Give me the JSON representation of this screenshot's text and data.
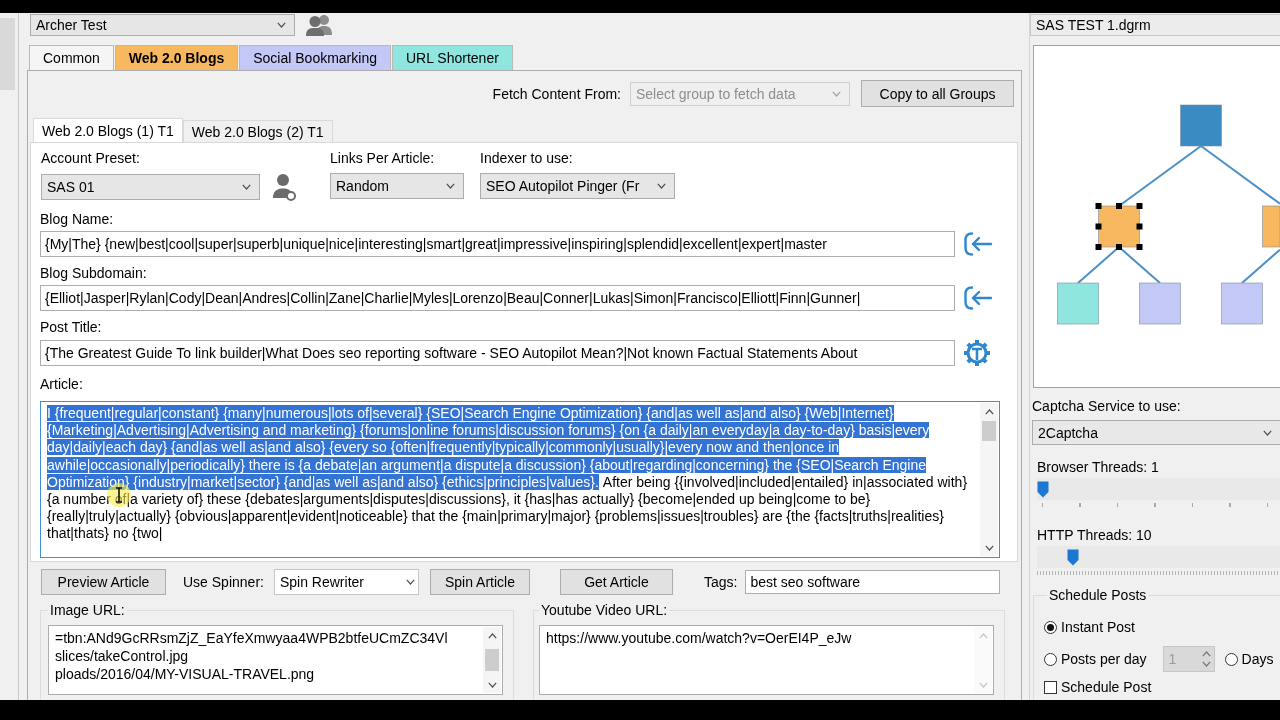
{
  "profile_select": {
    "value": "Archer Test"
  },
  "tabs": [
    {
      "label": "Common",
      "selected": false,
      "color": "#f5f5f5"
    },
    {
      "label": "Web 2.0 Blogs",
      "selected": true,
      "color": "#f8b860"
    },
    {
      "label": "Social Bookmarking",
      "selected": false,
      "color": "#c3c8f7"
    },
    {
      "label": "URL Shortener",
      "selected": false,
      "color": "#8fe6df"
    }
  ],
  "fetch": {
    "label": "Fetch Content From:",
    "select": {
      "placeholder": "Select group to fetch data",
      "disabled": true
    },
    "button": "Copy to all Groups"
  },
  "sub_tabs": [
    {
      "label": "Web 2.0 Blogs (1) T1",
      "selected": true
    },
    {
      "label": "Web 2.0 Blogs (2) T1",
      "selected": false
    }
  ],
  "form": {
    "account_preset": {
      "label": "Account Preset:",
      "value": "SAS 01"
    },
    "links_per_article": {
      "label": "Links Per Article:",
      "value": "Random"
    },
    "indexer": {
      "label": "Indexer to use:",
      "value": "SEO Autopilot Pinger (Fr"
    },
    "text_fields": [
      {
        "label": "Blog Name:",
        "value": "{My|The} {new|best|cool|super|superb|unique|nice|interesting|smart|great|impressive|inspiring|splendid|excellent|expert|master",
        "kind": "arrow"
      },
      {
        "label": "Blog Subdomain:",
        "value": "{Elliot|Jasper|Rylan|Cody|Dean|Andres|Collin|Zane|Charlie|Myles|Lorenzo|Beau|Conner|Lukas|Simon|Francisco|Elliott|Finn|Gunner|",
        "kind": "arrow"
      },
      {
        "label": "Post Title:",
        "value": "{The Greatest Guide To link builder|What Does seo reporting software - SEO Autopilot Mean?|Not known Factual Statements About",
        "kind": "tool"
      }
    ],
    "article": {
      "label": "Article:",
      "selected_text": "I {frequent|regular|constant} {many|numerous|lots of|several} {SEO|Search Engine Optimization} {and|as well as|and also} {Web|Internet} {Marketing|Advertising|Advertising and marketing} {forums|online forums|discussion forums} {on {a daily|an everyday|a day-to-day} basis|every day|daily|each day} {and|as well as|and also} {every so {often|frequently|typically|commonly|usually}|every now and then|once in awhile|occasionally|periodically} there is {a debate|an argument|a dispute|a discussion} {about|regarding|concerning} the {SEO|Search Engine Optimization} {industry|market|sector} {and|as well as|and also} {ethics|principles|values}.",
      "text": "After being {{involved|included|entailed} in|associated with} {a number of|a variety of} these {debates|arguments|disputes|discussions}, it {has|has actually} {become|ended up being|come to be} {really|truly|actually} {obvious|apparent|evident|noticeable} that the {main|primary|major} {problems|issues|troubles} are {the {facts|truths|realities} that|thats} no {two|"
    }
  },
  "actions": {
    "preview_button": "Preview Article",
    "spinner_label": "Use Spinner:",
    "spinner": "Spin Rewriter",
    "spin_button": "Spin Article",
    "get_button": "Get Article",
    "tags_label": "Tags:",
    "tags": "best seo software"
  },
  "image_url": {
    "label": "Image URL:",
    "lines": [
      "=tbn:ANd9GcRRsmZjZ_EaYfeXmwyaa4WPB2btfeUCmZC34Vl",
      "slices/takeControl.jpg",
      "ploads/2016/04/MY-VISUAL-TRAVEL.png"
    ]
  },
  "youtube_url": {
    "label": "Youtube Video URL:",
    "value": "https://www.youtube.com/watch?v=OerEI4P_eJw"
  },
  "side": {
    "diagram_file": "SAS TEST 1.dgrm",
    "diagram": {
      "nodes": [
        {
          "color": "#3a8bc2",
          "selected": false,
          "children": [
            {
              "color": "#f8b860",
              "selected": true,
              "children": [
                {
                  "color": "#8fe6df",
                  "selected": false
                },
                {
                  "color": "#c3c8f7",
                  "selected": false
                }
              ]
            },
            {
              "color": "#f8b860",
              "selected": false,
              "children": [
                {
                  "color": "#c3c8f7",
                  "selected": false
                }
              ]
            }
          ]
        }
      ]
    },
    "captcha": {
      "label": "Captcha Service to use:",
      "value": "2Captcha"
    },
    "sliders": [
      {
        "label": "Browser Threads: 1",
        "level": 0,
        "kind": "coarse"
      },
      {
        "label": "HTTP Threads: 10",
        "level": 0.13,
        "kind": "fine"
      }
    ],
    "schedule": {
      "title": "Schedule Posts",
      "options": [
        {
          "label": "Instant Post",
          "selected": true
        },
        {
          "label": "Posts per day",
          "selected": false
        },
        {
          "label": "Days",
          "selected": false
        }
      ],
      "posts_per_day": {
        "value": "1",
        "disabled": true
      },
      "schedule_post": {
        "label": "Schedule Post",
        "checked": false
      }
    }
  }
}
